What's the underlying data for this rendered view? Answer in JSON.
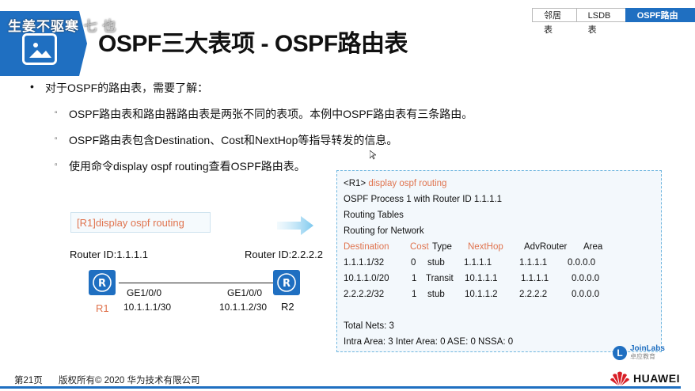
{
  "header": {
    "watermark": "生姜不驱寒",
    "watermark_ghost": "七 也",
    "title": "OSPF三大表项 - OSPF路由表"
  },
  "tabs": [
    {
      "label": "邻居表",
      "active": false
    },
    {
      "label": "LSDB表",
      "active": false
    },
    {
      "label": "OSPF路由表",
      "active": true
    }
  ],
  "bullets": {
    "main": "对于OSPF的路由表，需要了解：",
    "sub": [
      "OSPF路由表和路由器路由表是两张不同的表项。本例中OSPF路由表有三条路由。",
      "OSPF路由表包含Destination、Cost和NextHop等指导转发的信息。",
      "使用命令display ospf routing查看OSPF路由表。"
    ]
  },
  "command_box": "[R1]display ospf routing",
  "output": {
    "prompt": "<R1>",
    "command": " display ospf routing",
    "process_line": "OSPF Process 1 with Router ID 1.1.1.1",
    "routing_tables": "Routing Tables",
    "routing_for_network": "Routing for Network",
    "headers": {
      "destination": "Destination",
      "cost": "Cost",
      "type": "Type",
      "nexthop": "NextHop",
      "advrouter": "AdvRouter",
      "area": "Area"
    },
    "rows": [
      {
        "destination": "1.1.1.1/32",
        "cost": "0",
        "type": "stub",
        "nexthop": "1.1.1.1",
        "advrouter": "1.1.1.1",
        "area": "0.0.0.0"
      },
      {
        "destination": "10.1.1.0/20",
        "cost": "1",
        "type": "Transit",
        "nexthop": "10.1.1.1",
        "advrouter": "1.1.1.1",
        "area": "0.0.0.0"
      },
      {
        "destination": "2.2.2.2/32",
        "cost": "1",
        "type": "stub",
        "nexthop": "10.1.1.2",
        "advrouter": "2.2.2.2",
        "area": "0.0.0.0"
      }
    ],
    "total_nets": "Total Nets: 3",
    "summary": "Intra Area: 3  Inter Area: 0  ASE: 0  NSSA: 0"
  },
  "topology": {
    "r1": {
      "router_id": "Router ID:1.1.1.1",
      "interface": "GE1/0/0",
      "ip": "10.1.1.1/30",
      "name": "R1"
    },
    "r2": {
      "router_id": "Router ID:2.2.2.2",
      "interface": "GE1/0/0",
      "ip": "10.1.1.2/30",
      "name": "R2"
    }
  },
  "footer": {
    "page": "第21页",
    "copyright": "版权所有© 2020 华为技术有限公司",
    "brand": "HUAWEI",
    "joinlabs_brand": "JoinLabs",
    "joinlabs_sub": "卓应教育"
  },
  "colors": {
    "accent_blue": "#1f6fc1",
    "highlight_orange": "#e0744f",
    "r1_label": "#e0744f",
    "r2_label": "#111111"
  }
}
